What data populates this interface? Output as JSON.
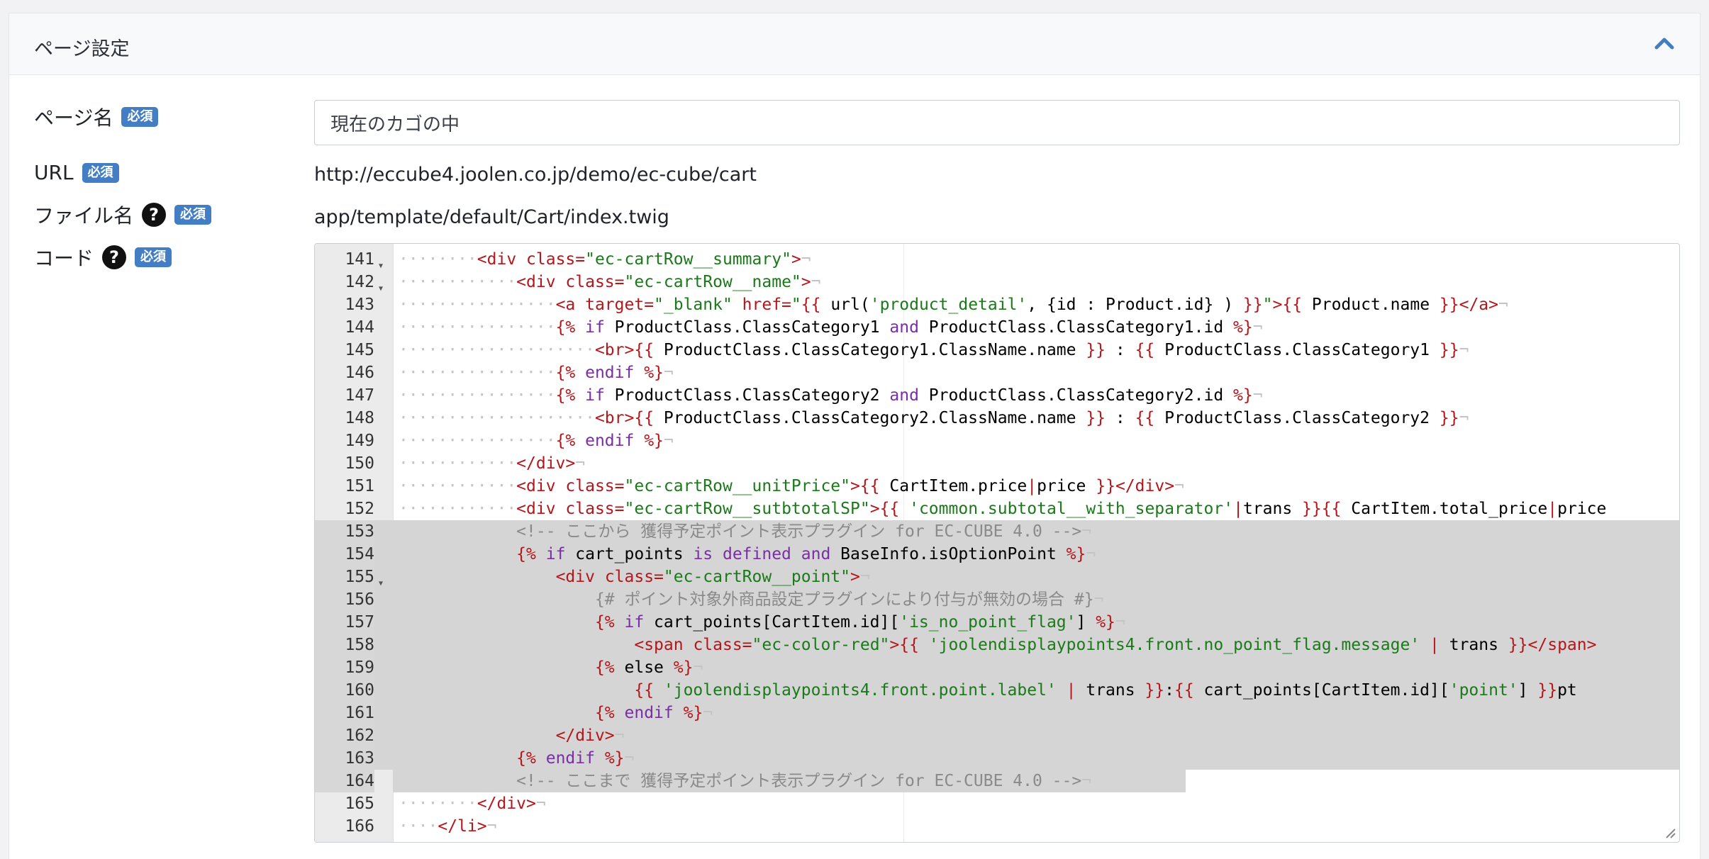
{
  "card": {
    "title": "ページ設定"
  },
  "form": {
    "page_name_label": "ページ名",
    "page_name_value": "現在のカゴの中",
    "url_label": "URL",
    "url_value": "http://eccube4.joolen.co.jp/demo/ec-cube/cart",
    "file_label": "ファイル名",
    "file_value": "app/template/default/Cart/index.twig",
    "code_label": "コード",
    "required_badge": "必須",
    "help_glyph": "?"
  },
  "editor": {
    "lines": [
      {
        "n": "141",
        "fold": true,
        "hl": "",
        "parts": [
          [
            "ws",
            "········"
          ],
          [
            "tg",
            "<div "
          ],
          [
            "at",
            "class="
          ],
          [
            "st",
            "\"ec-cartRow__summary\""
          ],
          [
            "tg",
            ">"
          ],
          [
            "ws",
            "¬"
          ]
        ]
      },
      {
        "n": "142",
        "fold": true,
        "hl": "",
        "parts": [
          [
            "ws",
            "············"
          ],
          [
            "tg",
            "<div "
          ],
          [
            "at",
            "class="
          ],
          [
            "st",
            "\"ec-cartRow__name\""
          ],
          [
            "tg",
            ">"
          ],
          [
            "ws",
            "¬"
          ]
        ]
      },
      {
        "n": "143",
        "fold": false,
        "hl": "",
        "parts": [
          [
            "ws",
            "················"
          ],
          [
            "tg",
            "<a "
          ],
          [
            "at",
            "target="
          ],
          [
            "st",
            "\"_blank\" "
          ],
          [
            "at",
            "href="
          ],
          [
            "st",
            "\""
          ],
          [
            "dl",
            "{{ "
          ],
          [
            "tx",
            "url("
          ],
          [
            "st",
            "'product_detail'"
          ],
          [
            "tx",
            ", {id : Product.id} ) "
          ],
          [
            "dl",
            "}}"
          ],
          [
            "st",
            "\""
          ],
          [
            "tg",
            ">"
          ],
          [
            "dl",
            "{{ "
          ],
          [
            "tx",
            "Product.name "
          ],
          [
            "dl",
            "}}"
          ],
          [
            "tg",
            "</a>"
          ],
          [
            "ws",
            "¬"
          ]
        ]
      },
      {
        "n": "144",
        "fold": false,
        "hl": "",
        "parts": [
          [
            "ws",
            "················"
          ],
          [
            "dl",
            "{% "
          ],
          [
            "kw",
            "if "
          ],
          [
            "tx",
            "ProductClass.ClassCategory1 "
          ],
          [
            "kw",
            "and "
          ],
          [
            "tx",
            "ProductClass.ClassCategory1.id "
          ],
          [
            "dl",
            "%}"
          ],
          [
            "ws",
            "¬"
          ]
        ]
      },
      {
        "n": "145",
        "fold": false,
        "hl": "",
        "parts": [
          [
            "ws",
            "····················"
          ],
          [
            "tg",
            "<br>"
          ],
          [
            "dl",
            "{{ "
          ],
          [
            "tx",
            "ProductClass.ClassCategory1.ClassName.name "
          ],
          [
            "dl",
            "}}"
          ],
          [
            "tx",
            " : "
          ],
          [
            "dl",
            "{{ "
          ],
          [
            "tx",
            "ProductClass.ClassCategory1 "
          ],
          [
            "dl",
            "}}"
          ],
          [
            "ws",
            "¬"
          ]
        ]
      },
      {
        "n": "146",
        "fold": false,
        "hl": "",
        "parts": [
          [
            "ws",
            "················"
          ],
          [
            "dl",
            "{% "
          ],
          [
            "kw",
            "endif "
          ],
          [
            "dl",
            "%}"
          ],
          [
            "ws",
            "¬"
          ]
        ]
      },
      {
        "n": "147",
        "fold": false,
        "hl": "",
        "parts": [
          [
            "ws",
            "················"
          ],
          [
            "dl",
            "{% "
          ],
          [
            "kw",
            "if "
          ],
          [
            "tx",
            "ProductClass.ClassCategory2 "
          ],
          [
            "kw",
            "and "
          ],
          [
            "tx",
            "ProductClass.ClassCategory2.id "
          ],
          [
            "dl",
            "%}"
          ],
          [
            "ws",
            "¬"
          ]
        ]
      },
      {
        "n": "148",
        "fold": false,
        "hl": "",
        "parts": [
          [
            "ws",
            "····················"
          ],
          [
            "tg",
            "<br>"
          ],
          [
            "dl",
            "{{ "
          ],
          [
            "tx",
            "ProductClass.ClassCategory2.ClassName.name "
          ],
          [
            "dl",
            "}}"
          ],
          [
            "tx",
            " : "
          ],
          [
            "dl",
            "{{ "
          ],
          [
            "tx",
            "ProductClass.ClassCategory2 "
          ],
          [
            "dl",
            "}}"
          ],
          [
            "ws",
            "¬"
          ]
        ]
      },
      {
        "n": "149",
        "fold": false,
        "hl": "",
        "parts": [
          [
            "ws",
            "················"
          ],
          [
            "dl",
            "{% "
          ],
          [
            "kw",
            "endif "
          ],
          [
            "dl",
            "%}"
          ],
          [
            "ws",
            "¬"
          ]
        ]
      },
      {
        "n": "150",
        "fold": false,
        "hl": "",
        "parts": [
          [
            "ws",
            "············"
          ],
          [
            "tg",
            "</div>"
          ],
          [
            "ws",
            "¬"
          ]
        ]
      },
      {
        "n": "151",
        "fold": false,
        "hl": "",
        "parts": [
          [
            "ws",
            "············"
          ],
          [
            "tg",
            "<div "
          ],
          [
            "at",
            "class="
          ],
          [
            "st",
            "\"ec-cartRow__unitPrice\""
          ],
          [
            "tg",
            ">"
          ],
          [
            "dl",
            "{{ "
          ],
          [
            "tx",
            "CartItem.price"
          ],
          [
            "dl",
            "|"
          ],
          [
            "tx",
            "price "
          ],
          [
            "dl",
            "}}"
          ],
          [
            "tg",
            "</div>"
          ],
          [
            "ws",
            "¬"
          ]
        ]
      },
      {
        "n": "152",
        "fold": false,
        "hl": "",
        "parts": [
          [
            "ws",
            "············"
          ],
          [
            "tg",
            "<div "
          ],
          [
            "at",
            "class="
          ],
          [
            "st",
            "\"ec-cartRow__sutbtotalSP\""
          ],
          [
            "tg",
            ">"
          ],
          [
            "dl",
            "{{ "
          ],
          [
            "st",
            "'common.subtotal__with_separator'"
          ],
          [
            "dl",
            "|"
          ],
          [
            "tx",
            "trans "
          ],
          [
            "dl",
            "}}{{ "
          ],
          [
            "tx",
            "CartItem.total_price"
          ],
          [
            "dl",
            "|"
          ],
          [
            "tx",
            "price"
          ]
        ]
      },
      {
        "n": "153",
        "fold": false,
        "hl": "full",
        "parts": [
          [
            "tx",
            "            "
          ],
          [
            "cm",
            "<!-- ここから 獲得予定ポイント表示プラグイン for EC-CUBE 4.0 -->"
          ],
          [
            "ws",
            "¬"
          ]
        ]
      },
      {
        "n": "154",
        "fold": false,
        "hl": "full",
        "parts": [
          [
            "tx",
            "            "
          ],
          [
            "dl",
            "{% "
          ],
          [
            "kw",
            "if "
          ],
          [
            "tx",
            "cart_points "
          ],
          [
            "kw",
            "is defined and "
          ],
          [
            "tx",
            "BaseInfo.isOptionPoint "
          ],
          [
            "dl",
            "%}"
          ],
          [
            "ws",
            "¬"
          ]
        ]
      },
      {
        "n": "155",
        "fold": true,
        "hl": "full",
        "parts": [
          [
            "tx",
            "                "
          ],
          [
            "tg",
            "<div "
          ],
          [
            "at",
            "class="
          ],
          [
            "st",
            "\"ec-cartRow__point\""
          ],
          [
            "tg",
            ">"
          ],
          [
            "ws",
            "¬"
          ]
        ]
      },
      {
        "n": "156",
        "fold": false,
        "hl": "full",
        "parts": [
          [
            "tx",
            "                    "
          ],
          [
            "cm",
            "{# ポイント対象外商品設定プラグインにより付与が無効の場合 #}"
          ],
          [
            "ws",
            "¬"
          ]
        ]
      },
      {
        "n": "157",
        "fold": false,
        "hl": "full",
        "parts": [
          [
            "tx",
            "                    "
          ],
          [
            "dl",
            "{% "
          ],
          [
            "kw",
            "if "
          ],
          [
            "tx",
            "cart_points[CartItem.id]["
          ],
          [
            "st",
            "'is_no_point_flag'"
          ],
          [
            "tx",
            "] "
          ],
          [
            "dl",
            "%}"
          ],
          [
            "ws",
            "¬"
          ]
        ]
      },
      {
        "n": "158",
        "fold": false,
        "hl": "full",
        "parts": [
          [
            "tx",
            "                        "
          ],
          [
            "tg",
            "<span "
          ],
          [
            "at",
            "class="
          ],
          [
            "st",
            "\"ec-color-red\""
          ],
          [
            "tg",
            ">"
          ],
          [
            "dl",
            "{{ "
          ],
          [
            "st",
            "'joolendisplaypoints4.front.no_point_flag.message' "
          ],
          [
            "dl",
            "| "
          ],
          [
            "tx",
            "trans "
          ],
          [
            "dl",
            "}}"
          ],
          [
            "tg",
            "</span>"
          ]
        ]
      },
      {
        "n": "159",
        "fold": false,
        "hl": "full",
        "parts": [
          [
            "tx",
            "                    "
          ],
          [
            "dl",
            "{% "
          ],
          [
            "tx",
            "else "
          ],
          [
            "dl",
            "%}"
          ],
          [
            "ws",
            "¬"
          ]
        ]
      },
      {
        "n": "160",
        "fold": false,
        "hl": "full",
        "parts": [
          [
            "tx",
            "                        "
          ],
          [
            "dl",
            "{{ "
          ],
          [
            "st",
            "'joolendisplaypoints4.front.point.label' "
          ],
          [
            "dl",
            "| "
          ],
          [
            "tx",
            "trans "
          ],
          [
            "dl",
            "}}"
          ],
          [
            "tx",
            ":"
          ],
          [
            "dl",
            "{{ "
          ],
          [
            "tx",
            "cart_points[CartItem.id]["
          ],
          [
            "st",
            "'point'"
          ],
          [
            "tx",
            "] "
          ],
          [
            "dl",
            "}}"
          ],
          [
            "tx",
            "pt"
          ]
        ]
      },
      {
        "n": "161",
        "fold": false,
        "hl": "full",
        "parts": [
          [
            "tx",
            "                    "
          ],
          [
            "dl",
            "{% "
          ],
          [
            "kw",
            "endif "
          ],
          [
            "dl",
            "%}"
          ],
          [
            "ws",
            "¬"
          ]
        ]
      },
      {
        "n": "162",
        "fold": false,
        "hl": "full",
        "parts": [
          [
            "tx",
            "                "
          ],
          [
            "tg",
            "</div>"
          ],
          [
            "ws",
            "¬"
          ]
        ]
      },
      {
        "n": "163",
        "fold": false,
        "hl": "full",
        "parts": [
          [
            "tx",
            "            "
          ],
          [
            "dl",
            "{% "
          ],
          [
            "kw",
            "endif "
          ],
          [
            "dl",
            "%}"
          ],
          [
            "ws",
            "¬"
          ]
        ]
      },
      {
        "n": "164",
        "fold": false,
        "hl": "part",
        "parts": [
          [
            "tx",
            "            "
          ],
          [
            "cm",
            "<!-- ここまで 獲得予定ポイント表示プラグイン for EC-CUBE 4.0 -->"
          ],
          [
            "ws",
            "¬"
          ]
        ]
      },
      {
        "n": "165",
        "fold": false,
        "hl": "",
        "parts": [
          [
            "ws",
            "········"
          ],
          [
            "tg",
            "</div>"
          ],
          [
            "ws",
            "¬"
          ]
        ]
      },
      {
        "n": "166",
        "fold": false,
        "hl": "",
        "parts": [
          [
            "ws",
            "····"
          ],
          [
            "tg",
            "</li>"
          ],
          [
            "ws",
            "¬"
          ]
        ]
      }
    ]
  },
  "colors": {
    "badge": "#437ec4",
    "accent": "#437ec4",
    "selection": "#d5d5d5"
  }
}
